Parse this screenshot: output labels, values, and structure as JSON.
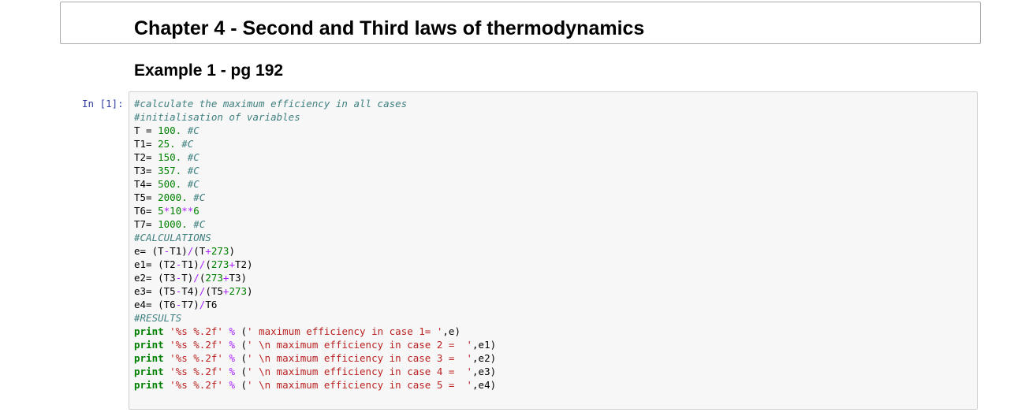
{
  "notebook": {
    "chapter_title": "Chapter 4 - Second and Third laws of thermodynamics",
    "example_title": "Example 1 - pg 192",
    "cell": {
      "prompt": "In [1]:",
      "lines": [
        [
          {
            "t": "#calculate the maximum efficiency in all cases",
            "k": "comment"
          }
        ],
        [
          {
            "t": "#initialisation of variables",
            "k": "comment"
          }
        ],
        [
          {
            "t": "T = ",
            "k": "name"
          },
          {
            "t": "100.",
            "k": "number"
          },
          {
            "t": " ",
            "k": "name"
          },
          {
            "t": "#C",
            "k": "comment"
          }
        ],
        [
          {
            "t": "T1= ",
            "k": "name"
          },
          {
            "t": "25.",
            "k": "number"
          },
          {
            "t": " ",
            "k": "name"
          },
          {
            "t": "#C",
            "k": "comment"
          }
        ],
        [
          {
            "t": "T2= ",
            "k": "name"
          },
          {
            "t": "150.",
            "k": "number"
          },
          {
            "t": " ",
            "k": "name"
          },
          {
            "t": "#C",
            "k": "comment"
          }
        ],
        [
          {
            "t": "T3= ",
            "k": "name"
          },
          {
            "t": "357.",
            "k": "number"
          },
          {
            "t": " ",
            "k": "name"
          },
          {
            "t": "#C",
            "k": "comment"
          }
        ],
        [
          {
            "t": "T4= ",
            "k": "name"
          },
          {
            "t": "500.",
            "k": "number"
          },
          {
            "t": " ",
            "k": "name"
          },
          {
            "t": "#C",
            "k": "comment"
          }
        ],
        [
          {
            "t": "T5= ",
            "k": "name"
          },
          {
            "t": "2000.",
            "k": "number"
          },
          {
            "t": " ",
            "k": "name"
          },
          {
            "t": "#C",
            "k": "comment"
          }
        ],
        [
          {
            "t": "T6= ",
            "k": "name"
          },
          {
            "t": "5",
            "k": "number"
          },
          {
            "t": "*",
            "k": "op"
          },
          {
            "t": "10",
            "k": "number"
          },
          {
            "t": "**",
            "k": "op"
          },
          {
            "t": "6",
            "k": "number"
          }
        ],
        [
          {
            "t": "T7= ",
            "k": "name"
          },
          {
            "t": "1000.",
            "k": "number"
          },
          {
            "t": " ",
            "k": "name"
          },
          {
            "t": "#C",
            "k": "comment"
          }
        ],
        [
          {
            "t": "#CALCULATIONS",
            "k": "comment"
          }
        ],
        [
          {
            "t": "e= (T",
            "k": "name"
          },
          {
            "t": "-",
            "k": "op"
          },
          {
            "t": "T1)",
            "k": "name"
          },
          {
            "t": "/",
            "k": "op"
          },
          {
            "t": "(T",
            "k": "name"
          },
          {
            "t": "+",
            "k": "op"
          },
          {
            "t": "273",
            "k": "number"
          },
          {
            "t": ")",
            "k": "name"
          }
        ],
        [
          {
            "t": "e1= (T2",
            "k": "name"
          },
          {
            "t": "-",
            "k": "op"
          },
          {
            "t": "T1)",
            "k": "name"
          },
          {
            "t": "/",
            "k": "op"
          },
          {
            "t": "(",
            "k": "name"
          },
          {
            "t": "273",
            "k": "number"
          },
          {
            "t": "+",
            "k": "op"
          },
          {
            "t": "T2)",
            "k": "name"
          }
        ],
        [
          {
            "t": "e2= (T3",
            "k": "name"
          },
          {
            "t": "-",
            "k": "op"
          },
          {
            "t": "T)",
            "k": "name"
          },
          {
            "t": "/",
            "k": "op"
          },
          {
            "t": "(",
            "k": "name"
          },
          {
            "t": "273",
            "k": "number"
          },
          {
            "t": "+",
            "k": "op"
          },
          {
            "t": "T3)",
            "k": "name"
          }
        ],
        [
          {
            "t": "e3= (T5",
            "k": "name"
          },
          {
            "t": "-",
            "k": "op"
          },
          {
            "t": "T4)",
            "k": "name"
          },
          {
            "t": "/",
            "k": "op"
          },
          {
            "t": "(T5",
            "k": "name"
          },
          {
            "t": "+",
            "k": "op"
          },
          {
            "t": "273",
            "k": "number"
          },
          {
            "t": ")",
            "k": "name"
          }
        ],
        [
          {
            "t": "e4= (T6",
            "k": "name"
          },
          {
            "t": "-",
            "k": "op"
          },
          {
            "t": "T7)",
            "k": "name"
          },
          {
            "t": "/",
            "k": "op"
          },
          {
            "t": "T6",
            "k": "name"
          }
        ],
        [
          {
            "t": "#RESULTS",
            "k": "comment"
          }
        ],
        [
          {
            "t": "print",
            "k": "keyword"
          },
          {
            "t": " ",
            "k": "name"
          },
          {
            "t": "'%s %.2f'",
            "k": "string"
          },
          {
            "t": " ",
            "k": "name"
          },
          {
            "t": "%",
            "k": "op"
          },
          {
            "t": " (",
            "k": "name"
          },
          {
            "t": "' maximum efficiency in case 1= '",
            "k": "string"
          },
          {
            "t": ",e)",
            "k": "name"
          }
        ],
        [
          {
            "t": "print",
            "k": "keyword"
          },
          {
            "t": " ",
            "k": "name"
          },
          {
            "t": "'%s %.2f'",
            "k": "string"
          },
          {
            "t": " ",
            "k": "name"
          },
          {
            "t": "%",
            "k": "op"
          },
          {
            "t": " (",
            "k": "name"
          },
          {
            "t": "' \\n maximum efficiency in case 2 =  '",
            "k": "string"
          },
          {
            "t": ",e1)",
            "k": "name"
          }
        ],
        [
          {
            "t": "print",
            "k": "keyword"
          },
          {
            "t": " ",
            "k": "name"
          },
          {
            "t": "'%s %.2f'",
            "k": "string"
          },
          {
            "t": " ",
            "k": "name"
          },
          {
            "t": "%",
            "k": "op"
          },
          {
            "t": " (",
            "k": "name"
          },
          {
            "t": "' \\n maximum efficiency in case 3 =  '",
            "k": "string"
          },
          {
            "t": ",e2)",
            "k": "name"
          }
        ],
        [
          {
            "t": "print",
            "k": "keyword"
          },
          {
            "t": " ",
            "k": "name"
          },
          {
            "t": "'%s %.2f'",
            "k": "string"
          },
          {
            "t": " ",
            "k": "name"
          },
          {
            "t": "%",
            "k": "op"
          },
          {
            "t": " (",
            "k": "name"
          },
          {
            "t": "' \\n maximum efficiency in case 4 =  '",
            "k": "string"
          },
          {
            "t": ",e3)",
            "k": "name"
          }
        ],
        [
          {
            "t": "print",
            "k": "keyword"
          },
          {
            "t": " ",
            "k": "name"
          },
          {
            "t": "'%s %.2f'",
            "k": "string"
          },
          {
            "t": " ",
            "k": "name"
          },
          {
            "t": "%",
            "k": "op"
          },
          {
            "t": " (",
            "k": "name"
          },
          {
            "t": "' \\n maximum efficiency in case 5 =  '",
            "k": "string"
          },
          {
            "t": ",e4)",
            "k": "name"
          }
        ]
      ]
    }
  },
  "colors": {
    "comment": "#408080",
    "number": "#008000",
    "operator": "#aa22ff",
    "string": "#ba2121",
    "keyword": "#008000",
    "prompt": "#303f9f",
    "code_background": "#f7f7f7",
    "cell_border": "#cfcfcf"
  }
}
